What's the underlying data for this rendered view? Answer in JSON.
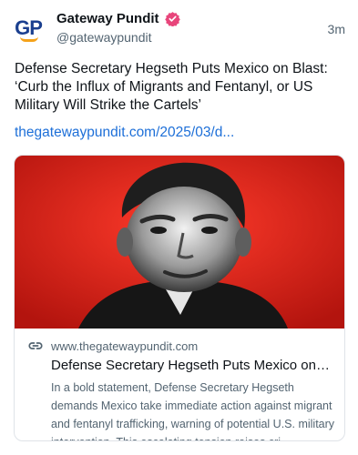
{
  "author": {
    "display_name": "Gateway Pundit",
    "handle": "@gatewaypundit",
    "avatar_text": "GP",
    "verified_icon": "verified-badge-icon",
    "verified_color": "#e8457b"
  },
  "post": {
    "time": "3m",
    "text": "Defense Secretary Hegseth Puts Mexico on Blast: ‘Curb the Influx of Migrants and Fentanyl, or US Military Will Strike the Cartels’",
    "link_text": "thegatewaypundit.com/2025/03/d..."
  },
  "card": {
    "image_icon": "article-photo",
    "image_background_color": "#e0281e",
    "link_icon": "link-icon",
    "domain": "www.thegatewaypundit.com",
    "title": "Defense Secretary Hegseth Puts Mexico on Bl...",
    "description": "In a bold statement, Defense Secretary Hegseth demands Mexico take immediate action against migrant and fentanyl trafficking, warning of potential U.S. military intervention. This escalating tension raises cri..."
  },
  "colors": {
    "link": "#1d6fd8",
    "muted_text": "#536471",
    "brand_blue": "#1b3f8f",
    "brand_orange": "#f5a21a"
  }
}
